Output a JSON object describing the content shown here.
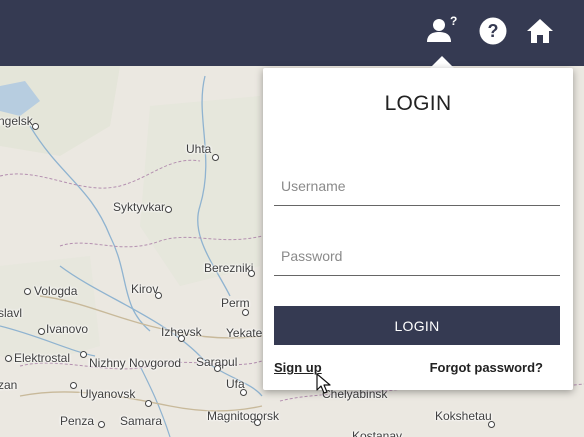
{
  "header": {
    "icons": [
      {
        "name": "user-question-icon"
      },
      {
        "name": "help-icon"
      },
      {
        "name": "home-icon"
      }
    ],
    "color": "#353a52"
  },
  "map": {
    "cities": [
      {
        "label": "ngelsk"
      },
      {
        "label": "Uhta"
      },
      {
        "label": "Syktyvkar"
      },
      {
        "label": "Berezniki"
      },
      {
        "label": "Vologda"
      },
      {
        "label": "Kirov"
      },
      {
        "label": "Perm"
      },
      {
        "label": "slavl"
      },
      {
        "label": "Ivanovo"
      },
      {
        "label": "Izhevsk"
      },
      {
        "label": "Yekate"
      },
      {
        "label": "Elektrostal"
      },
      {
        "label": "Nizhny Novgorod"
      },
      {
        "label": "Sarapul"
      },
      {
        "label": "zan"
      },
      {
        "label": "Ulyanovsk"
      },
      {
        "label": "Ufa"
      },
      {
        "label": "Chelyabinsk"
      },
      {
        "label": "Penza"
      },
      {
        "label": "Samara"
      },
      {
        "label": "Magnitogorsk"
      },
      {
        "label": "Kokshetau"
      },
      {
        "label": "Kostanay"
      }
    ]
  },
  "login": {
    "title": "LOGIN",
    "username_placeholder": "Username",
    "password_placeholder": "Password",
    "button_label": "LOGIN",
    "signup_label": "Sign up",
    "forgot_label": "Forgot password?"
  }
}
